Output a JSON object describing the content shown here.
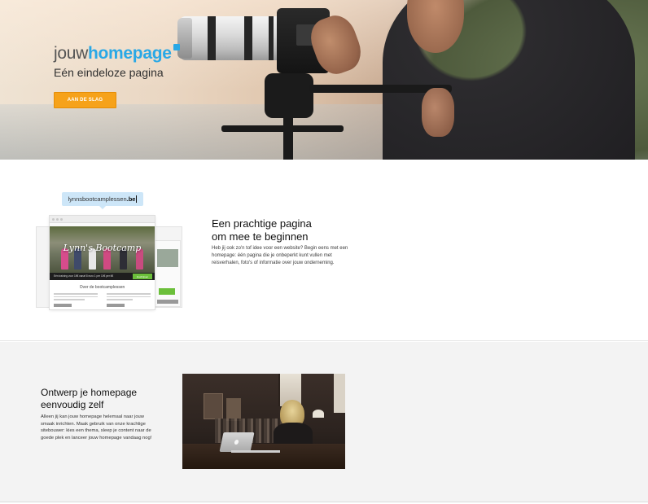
{
  "hero": {
    "brand_part1": "jouw",
    "brand_part2": "homepage",
    "subtitle": "Eén eindeloze pagina",
    "cta_label": "AAN DE SLAG",
    "accent_color": "#29a8e6",
    "cta_color": "#f6a21a"
  },
  "feature": {
    "url_name": "lynnsbootcamplessen",
    "url_tld": ".be",
    "mock_site_title": "Lynn's Bootcamp",
    "mock_strip_text": "Eén training voor 15€ vanaf 8 euro 1 per 10€ per 6€",
    "mock_strip_button": "Inschrijven",
    "mock_about": "Over de bootcamplessen",
    "mock_side_button": "Inschrijven",
    "title_line1": "Een prachtige pagina",
    "title_line2": "om mee te beginnen",
    "body": "Heb jij ook zo'n tof idee voor een website? Begin eens met een homepage: één pagina die je onbeperkt kunt vullen met reisverhalen, foto's of informatie over jouw onderneming."
  },
  "ontwerp": {
    "title_line1": "Ontwerp je homepage",
    "title_line2": "eenvoudig zelf",
    "body": "Alleen jij kan jouw homepage helemaal naar jouw smaak inrichten. Maak gebruik van onze krachtige sitebouwer: kies een thema, sleep je content naar de goede plek en lanceer jouw homepage vandaag nog!"
  }
}
